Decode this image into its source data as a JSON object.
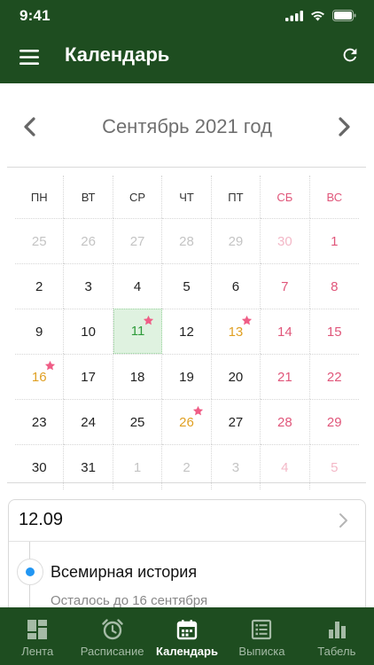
{
  "status": {
    "time": "9:41"
  },
  "header": {
    "title": "Календарь"
  },
  "calendar": {
    "month_title": "Сентябрь 2021 год",
    "weekdays": [
      {
        "label": "ПН",
        "weekend": false
      },
      {
        "label": "ВТ",
        "weekend": false
      },
      {
        "label": "СР",
        "weekend": false
      },
      {
        "label": "ЧТ",
        "weekend": false
      },
      {
        "label": "ПТ",
        "weekend": false
      },
      {
        "label": "СБ",
        "weekend": true
      },
      {
        "label": "ВС",
        "weekend": true
      }
    ],
    "days": [
      {
        "n": "25",
        "muted": true,
        "weekend": false
      },
      {
        "n": "26",
        "muted": true,
        "weekend": false
      },
      {
        "n": "27",
        "muted": true,
        "weekend": false
      },
      {
        "n": "28",
        "muted": true,
        "weekend": false
      },
      {
        "n": "29",
        "muted": true,
        "weekend": false
      },
      {
        "n": "30",
        "muted": true,
        "weekend": true
      },
      {
        "n": "1",
        "muted": false,
        "weekend": true
      },
      {
        "n": "2",
        "muted": false,
        "weekend": false
      },
      {
        "n": "3",
        "muted": false,
        "weekend": false
      },
      {
        "n": "4",
        "muted": false,
        "weekend": false
      },
      {
        "n": "5",
        "muted": false,
        "weekend": false
      },
      {
        "n": "6",
        "muted": false,
        "weekend": false
      },
      {
        "n": "7",
        "muted": false,
        "weekend": true
      },
      {
        "n": "8",
        "muted": false,
        "weekend": true
      },
      {
        "n": "9",
        "muted": false,
        "weekend": false
      },
      {
        "n": "10",
        "muted": false,
        "weekend": false
      },
      {
        "n": "11",
        "muted": false,
        "weekend": false,
        "today": true,
        "star": true
      },
      {
        "n": "12",
        "muted": false,
        "weekend": false
      },
      {
        "n": "13",
        "muted": false,
        "weekend": false,
        "event": true,
        "star": true
      },
      {
        "n": "14",
        "muted": false,
        "weekend": true
      },
      {
        "n": "15",
        "muted": false,
        "weekend": true
      },
      {
        "n": "16",
        "muted": false,
        "weekend": false,
        "event": true,
        "star": true
      },
      {
        "n": "17",
        "muted": false,
        "weekend": false
      },
      {
        "n": "18",
        "muted": false,
        "weekend": false
      },
      {
        "n": "19",
        "muted": false,
        "weekend": false
      },
      {
        "n": "20",
        "muted": false,
        "weekend": false
      },
      {
        "n": "21",
        "muted": false,
        "weekend": true
      },
      {
        "n": "22",
        "muted": false,
        "weekend": true
      },
      {
        "n": "23",
        "muted": false,
        "weekend": false
      },
      {
        "n": "24",
        "muted": false,
        "weekend": false
      },
      {
        "n": "25",
        "muted": false,
        "weekend": false
      },
      {
        "n": "26",
        "muted": false,
        "weekend": false,
        "event": true,
        "star": true
      },
      {
        "n": "27",
        "muted": false,
        "weekend": false
      },
      {
        "n": "28",
        "muted": false,
        "weekend": true
      },
      {
        "n": "29",
        "muted": false,
        "weekend": true
      },
      {
        "n": "30",
        "muted": false,
        "weekend": false
      },
      {
        "n": "31",
        "muted": false,
        "weekend": false
      },
      {
        "n": "1",
        "muted": true,
        "weekend": false
      },
      {
        "n": "2",
        "muted": true,
        "weekend": false
      },
      {
        "n": "3",
        "muted": true,
        "weekend": false
      },
      {
        "n": "4",
        "muted": true,
        "weekend": true
      },
      {
        "n": "5",
        "muted": true,
        "weekend": true
      }
    ]
  },
  "selected_day": {
    "date": "12.09",
    "lesson_title": "Всемирная история",
    "lesson_subtitle": "Осталось до 16 сентября"
  },
  "tabbar": {
    "items": [
      {
        "label": "Лента",
        "icon": "dashboard-icon",
        "active": false
      },
      {
        "label": "Расписание",
        "icon": "alarm-clock-icon",
        "active": false
      },
      {
        "label": "Календарь",
        "icon": "calendar-icon",
        "active": true
      },
      {
        "label": "Выписка",
        "icon": "list-document-icon",
        "active": false
      },
      {
        "label": "Табель",
        "icon": "bar-chart-icon",
        "active": false
      }
    ]
  },
  "colors": {
    "brand": "#1e4d20",
    "weekend": "#e0567a",
    "event": "#e0a023",
    "today_bg": "#dff2e0",
    "today_text": "#2e9b3a",
    "dot": "#2196f3"
  }
}
